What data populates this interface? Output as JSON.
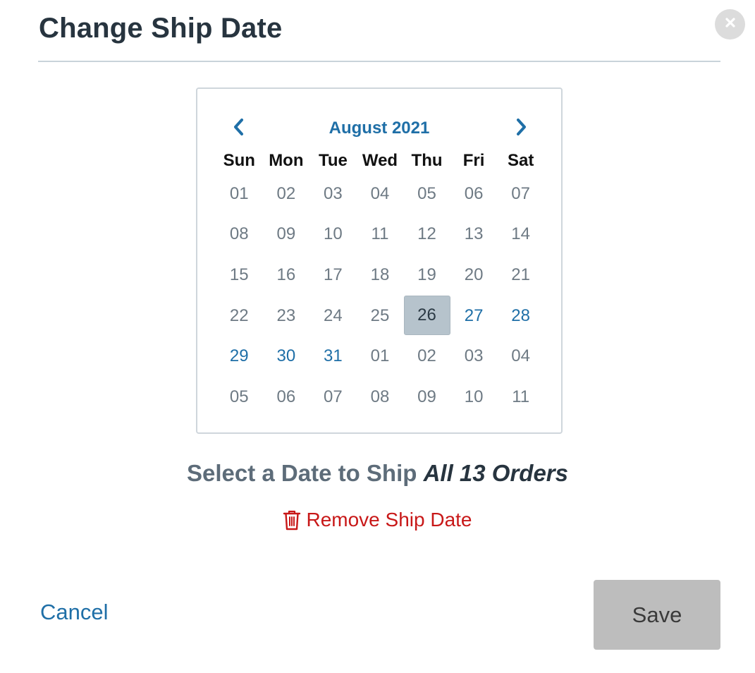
{
  "dialog": {
    "title": "Change Ship Date",
    "close_icon": "close-icon"
  },
  "calendar": {
    "month_label": "August 2021",
    "prev_icon": "chevron-left-icon",
    "next_icon": "chevron-right-icon",
    "weekdays": [
      "Sun",
      "Mon",
      "Tue",
      "Wed",
      "Thu",
      "Fri",
      "Sat"
    ],
    "days": [
      {
        "label": "01",
        "state": "disabled"
      },
      {
        "label": "02",
        "state": "disabled"
      },
      {
        "label": "03",
        "state": "disabled"
      },
      {
        "label": "04",
        "state": "disabled"
      },
      {
        "label": "05",
        "state": "disabled"
      },
      {
        "label": "06",
        "state": "disabled"
      },
      {
        "label": "07",
        "state": "disabled"
      },
      {
        "label": "08",
        "state": "disabled"
      },
      {
        "label": "09",
        "state": "disabled"
      },
      {
        "label": "10",
        "state": "disabled"
      },
      {
        "label": "11",
        "state": "disabled"
      },
      {
        "label": "12",
        "state": "disabled"
      },
      {
        "label": "13",
        "state": "disabled"
      },
      {
        "label": "14",
        "state": "disabled"
      },
      {
        "label": "15",
        "state": "disabled"
      },
      {
        "label": "16",
        "state": "disabled"
      },
      {
        "label": "17",
        "state": "disabled"
      },
      {
        "label": "18",
        "state": "disabled"
      },
      {
        "label": "19",
        "state": "disabled"
      },
      {
        "label": "20",
        "state": "disabled"
      },
      {
        "label": "21",
        "state": "disabled"
      },
      {
        "label": "22",
        "state": "disabled"
      },
      {
        "label": "23",
        "state": "disabled"
      },
      {
        "label": "24",
        "state": "disabled"
      },
      {
        "label": "25",
        "state": "disabled"
      },
      {
        "label": "26",
        "state": "selected"
      },
      {
        "label": "27",
        "state": "available"
      },
      {
        "label": "28",
        "state": "available"
      },
      {
        "label": "29",
        "state": "available"
      },
      {
        "label": "30",
        "state": "available"
      },
      {
        "label": "31",
        "state": "available"
      },
      {
        "label": "01",
        "state": "disabled"
      },
      {
        "label": "02",
        "state": "disabled"
      },
      {
        "label": "03",
        "state": "disabled"
      },
      {
        "label": "04",
        "state": "disabled"
      },
      {
        "label": "05",
        "state": "disabled"
      },
      {
        "label": "06",
        "state": "disabled"
      },
      {
        "label": "07",
        "state": "disabled"
      },
      {
        "label": "08",
        "state": "disabled"
      },
      {
        "label": "09",
        "state": "disabled"
      },
      {
        "label": "10",
        "state": "disabled"
      },
      {
        "label": "11",
        "state": "disabled"
      }
    ]
  },
  "prompt": {
    "lead": "Select a Date to Ship ",
    "emphasis": "All 13 Orders"
  },
  "remove": {
    "label": "Remove Ship Date",
    "icon": "trash-icon"
  },
  "footer": {
    "cancel_label": "Cancel",
    "save_label": "Save"
  },
  "colors": {
    "title": "#27343f",
    "accent": "#1f6fa7",
    "danger": "#c81818",
    "selected_bg": "#b6c3cc",
    "save_disabled_bg": "#bdbdbd"
  }
}
